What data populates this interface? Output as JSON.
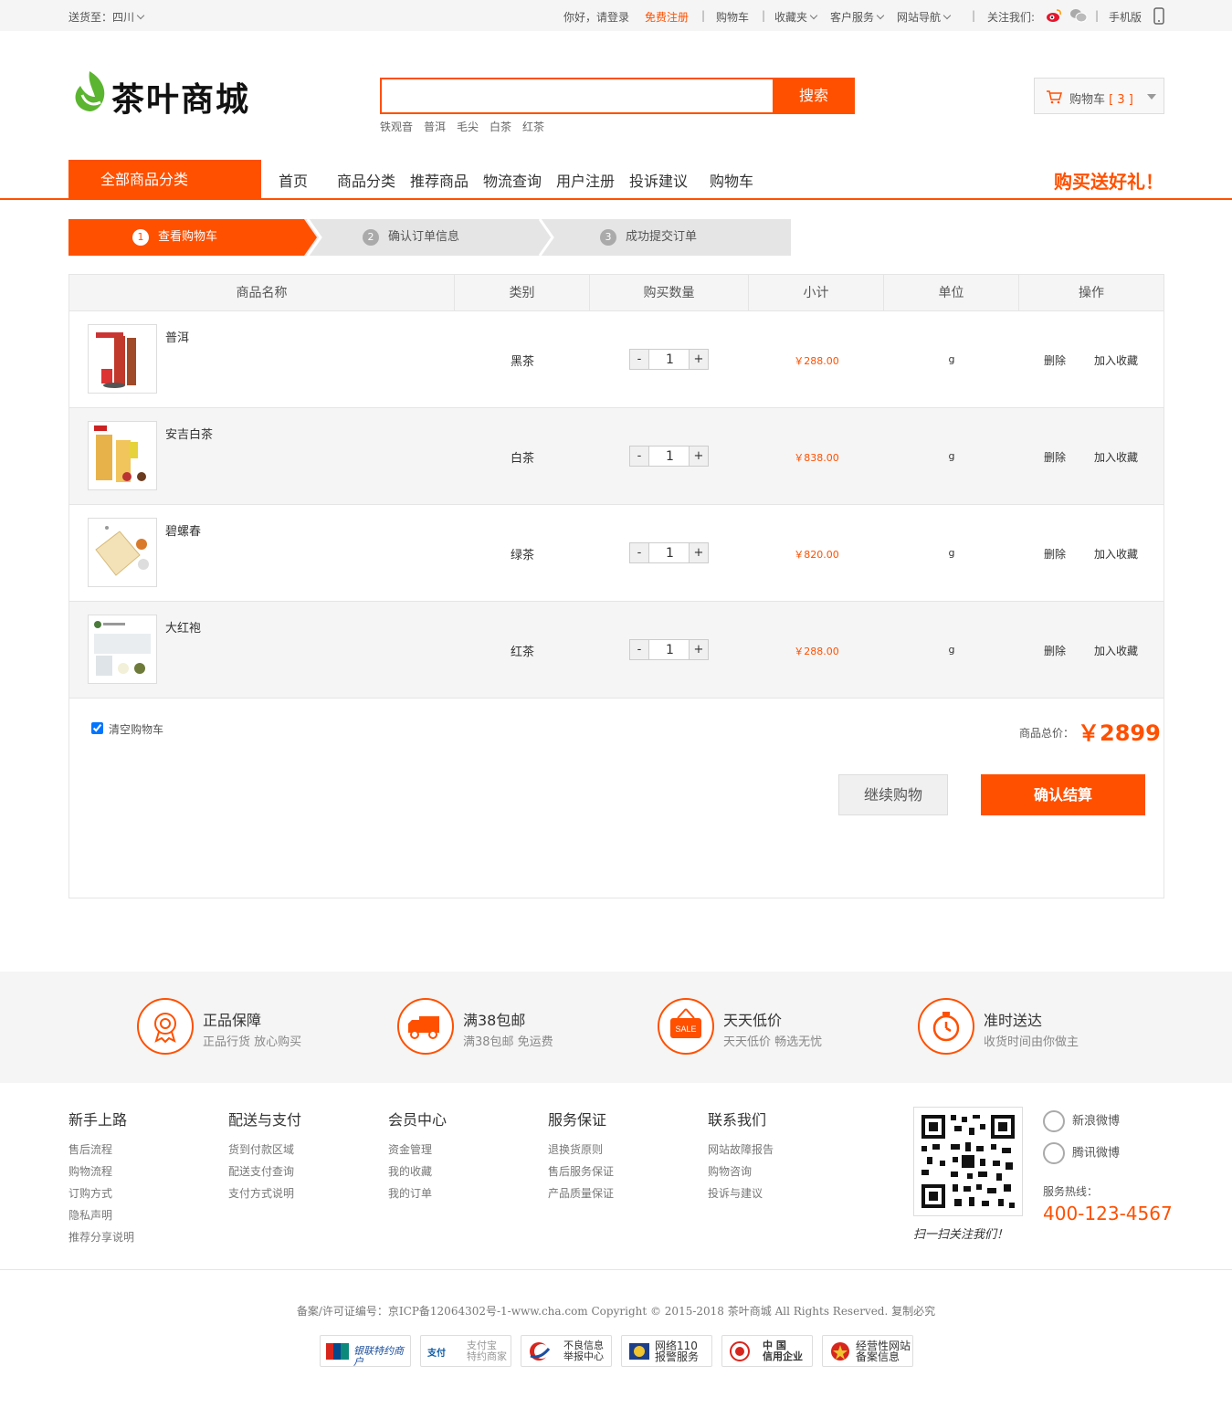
{
  "topbar": {
    "ship_to": "送货至：四川",
    "greeting": "你好，请登录",
    "register": "免费注册",
    "cart": "购物车",
    "favorites": "收藏夹",
    "service": "客户服务",
    "site_nav": "网站导航",
    "follow": "关注我们:",
    "mobile": "手机版"
  },
  "header": {
    "logo_text": "茶叶商城",
    "search_placeholder": "",
    "search_button": "搜索",
    "hot_words": [
      "铁观音",
      "普洱",
      "毛尖",
      "白茶",
      "红茶"
    ],
    "cart_label": "购物车",
    "cart_count": "[ 3 ]"
  },
  "nav": {
    "all_categories": "全部商品分类",
    "items": [
      "首页",
      "商品分类",
      "推荐商品",
      "物流查询",
      "用户注册",
      "投诉建议",
      "购物车"
    ],
    "promo": "购买送好礼！"
  },
  "steps": [
    {
      "num": "1",
      "label": "查看购物车"
    },
    {
      "num": "2",
      "label": "确认订单信息"
    },
    {
      "num": "3",
      "label": "成功提交订单"
    }
  ],
  "table": {
    "headers": [
      "商品名称",
      "类别",
      "购买数量",
      "小计",
      "单位",
      "操作"
    ],
    "rows": [
      {
        "name": "普洱",
        "category": "黑茶",
        "qty": "1",
        "subtotal": "￥288.00",
        "unit": "g",
        "delete": "删除",
        "favorite": "加入收藏"
      },
      {
        "name": "安吉白茶",
        "category": "白茶",
        "qty": "1",
        "subtotal": "￥838.00",
        "unit": "g",
        "delete": "删除",
        "favorite": "加入收藏"
      },
      {
        "name": "碧螺春",
        "category": "绿茶",
        "qty": "1",
        "subtotal": "￥820.00",
        "unit": "g",
        "delete": "删除",
        "favorite": "加入收藏"
      },
      {
        "name": "大红袍",
        "category": "红茶",
        "qty": "1",
        "subtotal": "￥288.00",
        "unit": "g",
        "delete": "删除",
        "favorite": "加入收藏"
      }
    ],
    "minus": "-",
    "plus": "+",
    "clear_cart": "清空购物车",
    "total_label": "商品总价：",
    "total_value": "￥2899",
    "continue_button": "继续购物",
    "checkout_button": "确认结算"
  },
  "services": [
    {
      "title": "正品保障",
      "sub": "正品行货 放心购买",
      "icon": "award-icon"
    },
    {
      "title": "满38包邮",
      "sub": "满38包邮 免运费",
      "icon": "truck-icon"
    },
    {
      "title": "天天低价",
      "sub": "天天低价 畅选无忧",
      "icon": "sale-tag-icon",
      "icon_text": "SALE"
    },
    {
      "title": "准时送达",
      "sub": "收货时间由你做主",
      "icon": "stopwatch-icon"
    }
  ],
  "footer": {
    "columns": [
      {
        "title": "新手上路",
        "items": [
          "售后流程",
          "购物流程",
          "订购方式",
          "隐私声明",
          "推荐分享说明"
        ]
      },
      {
        "title": "配送与支付",
        "items": [
          "货到付款区域",
          "配送支付查询",
          "支付方式说明"
        ]
      },
      {
        "title": "会员中心",
        "items": [
          "资金管理",
          "我的收藏",
          "我的订单"
        ]
      },
      {
        "title": "服务保证",
        "items": [
          "退换货原则",
          "售后服务保证",
          "产品质量保证"
        ]
      },
      {
        "title": "联系我们",
        "items": [
          "网站故障报告",
          "购物咨询",
          "投诉与建议"
        ]
      }
    ],
    "qr_caption": "扫一扫关注我们！",
    "weibo_sina": "新浪微博",
    "weibo_tencent": "腾讯微博",
    "hotline_label": "服务热线：",
    "hotline": "400-123-4567",
    "copyright": "备案/许可证编号：京ICP备12064302号-1-www.cha.com Copyright © 2015-2018 茶叶商城 All Rights Reserved. 复制必究",
    "badges": [
      {
        "line1": "银联特约商户",
        "line2": ""
      },
      {
        "line1": "支付宝",
        "line2": "特约商家"
      },
      {
        "line1": "不良信息",
        "line2": "举报中心"
      },
      {
        "line1": "网络110",
        "line2": "报警服务"
      },
      {
        "line1": "中 国",
        "line2": "信用企业"
      },
      {
        "line1": "经营性网站",
        "line2": "备案信息"
      }
    ]
  },
  "colors": {
    "accent": "#ff5000",
    "logo_green": "#5cb531"
  }
}
